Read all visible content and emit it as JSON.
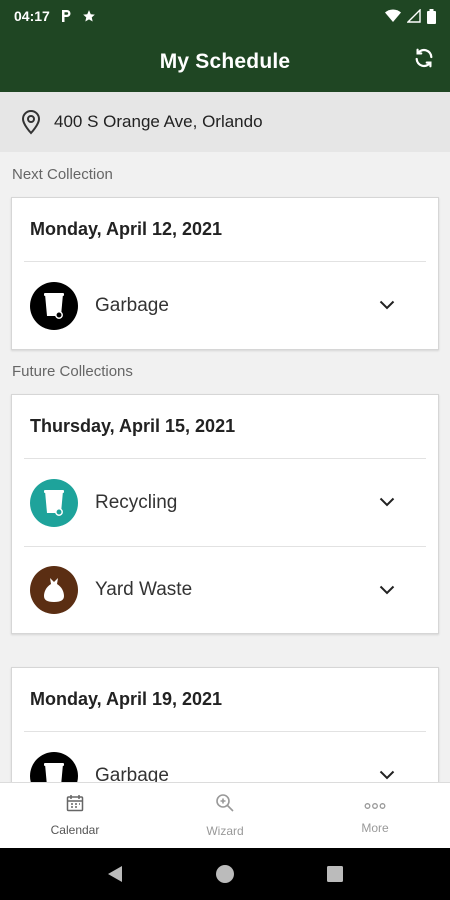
{
  "status_bar": {
    "time": "04:17",
    "icons": [
      "parking-p-icon",
      "star-icon",
      "wifi-icon",
      "signal-icon",
      "battery-icon"
    ]
  },
  "header": {
    "title": "My Schedule",
    "refresh_icon": "refresh-icon"
  },
  "address": {
    "icon": "location-pin-icon",
    "text": "400 S Orange Ave, Orlando"
  },
  "sections": {
    "next_label": "Next Collection",
    "future_label": "Future Collections"
  },
  "cards": [
    {
      "date": "Monday, April 12, 2021",
      "items": [
        {
          "name": "Garbage",
          "icon": "garbage-cart-icon",
          "color": "#000000"
        }
      ]
    },
    {
      "date": "Thursday, April 15, 2021",
      "items": [
        {
          "name": "Recycling",
          "icon": "recycling-cart-icon",
          "color": "#1ea39b"
        },
        {
          "name": "Yard Waste",
          "icon": "yard-waste-bag-icon",
          "color": "#5b2e13"
        }
      ]
    },
    {
      "date": "Monday, April 19, 2021",
      "items": [
        {
          "name": "Garbage",
          "icon": "garbage-cart-icon",
          "color": "#000000"
        }
      ]
    }
  ],
  "bottom_nav": [
    {
      "label": "Calendar",
      "icon": "calendar-icon",
      "active": true
    },
    {
      "label": "Wizard",
      "icon": "magnifier-icon",
      "active": false
    },
    {
      "label": "More",
      "icon": "more-dots-icon",
      "active": false
    }
  ],
  "colors": {
    "header_bg": "#1f4623",
    "address_bg": "#e6e6e6",
    "page_bg": "#f1f1f1"
  }
}
